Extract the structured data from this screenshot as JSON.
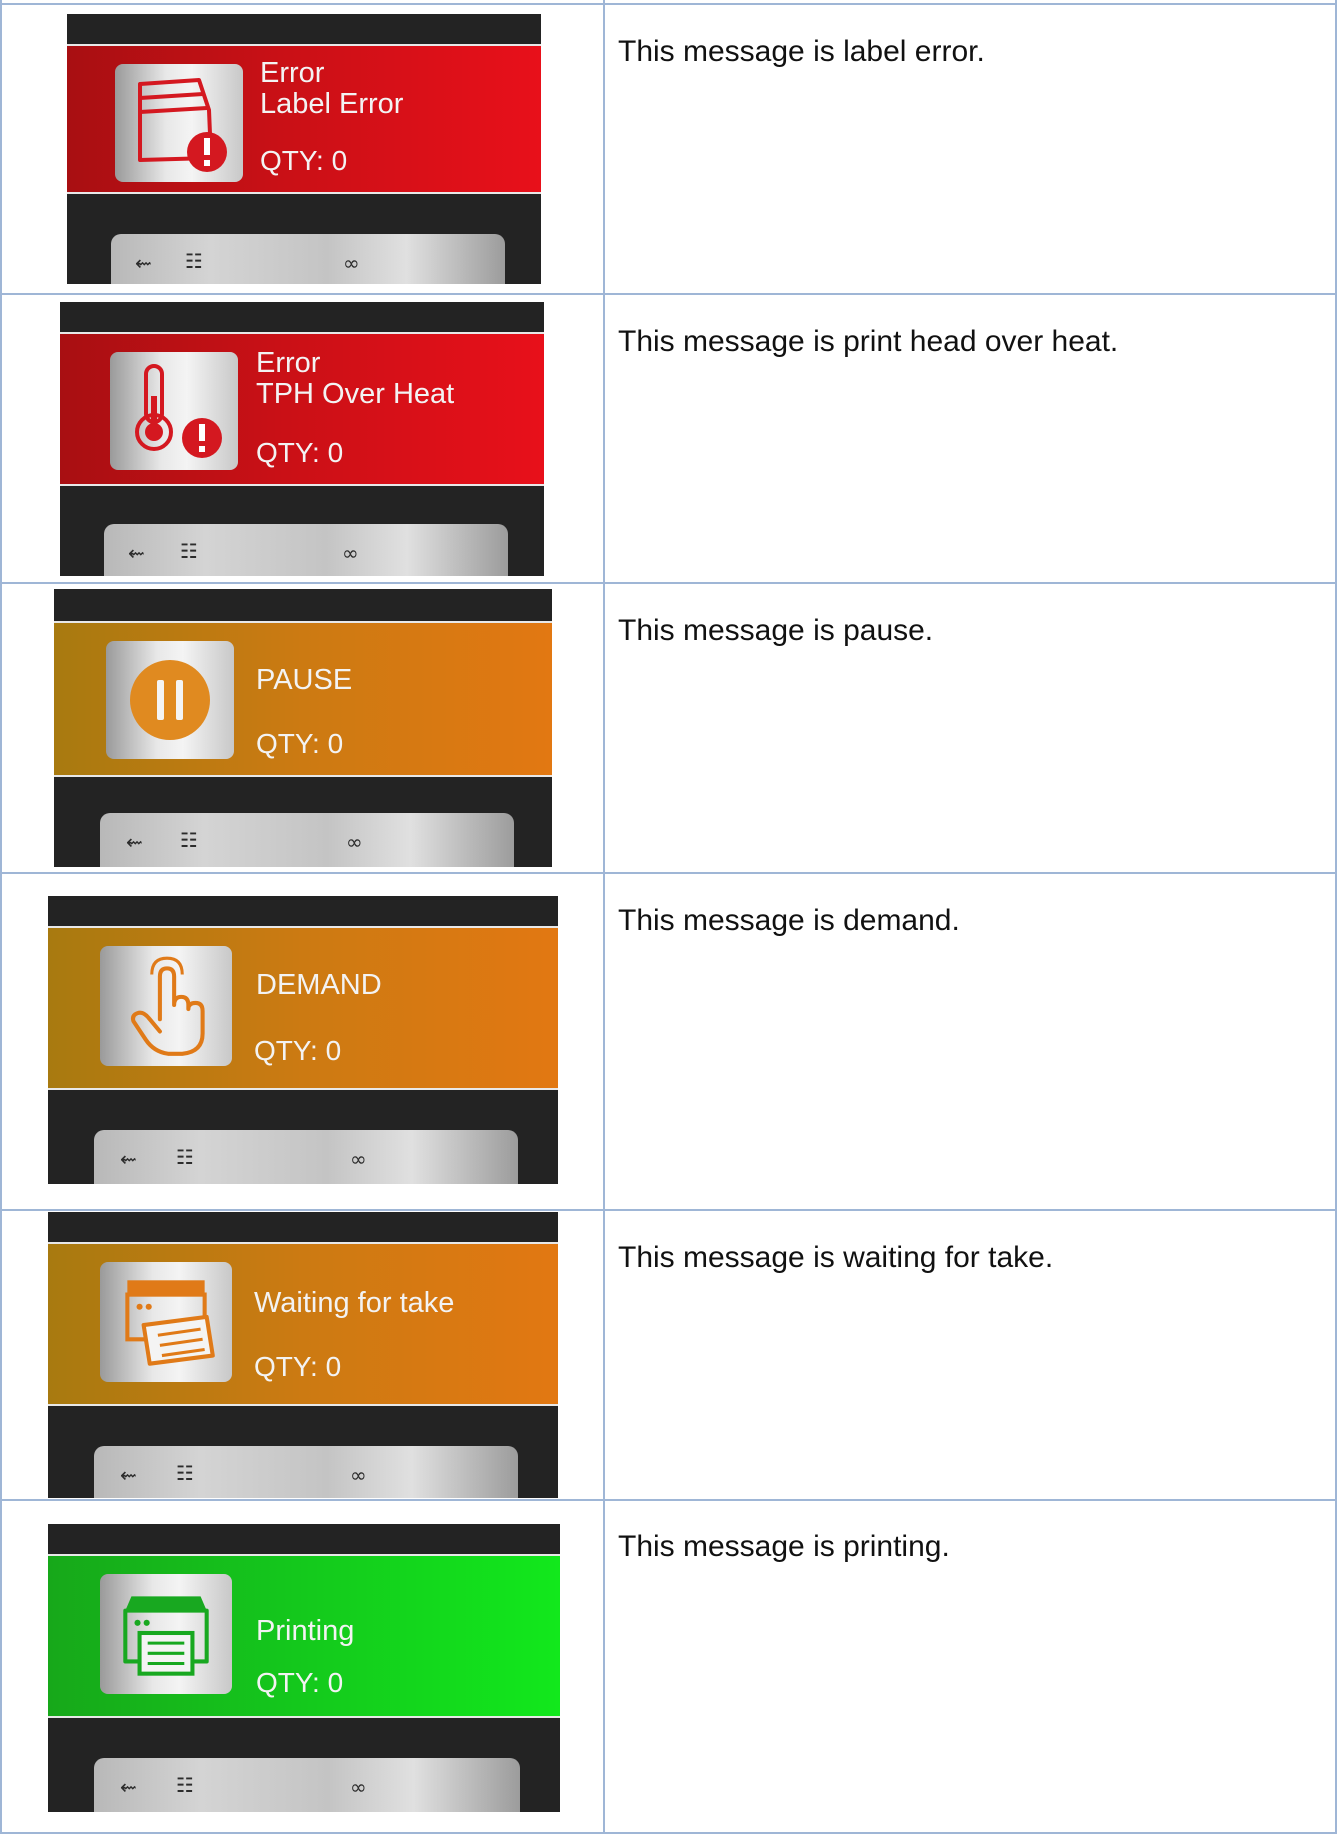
{
  "tray_icons": {
    "usb": "usb-icon",
    "network": "network-icon",
    "ribbon": "ribbon-icon"
  },
  "colors": {
    "error": "#d0101a",
    "warning": "#d07a12",
    "ok": "#14c91c"
  },
  "rows": [
    {
      "title": "Error\nLabel Error",
      "qty": "QTY: 0",
      "icon": "label-error-icon",
      "description": "This message is label error."
    },
    {
      "title": "Error\nTPH Over Heat",
      "qty": "QTY: 0",
      "icon": "thermometer-warning-icon",
      "description": "This message is print head over heat."
    },
    {
      "title": "PAUSE",
      "qty": "QTY: 0",
      "icon": "pause-icon",
      "description": "This message is pause."
    },
    {
      "title": "DEMAND",
      "qty": "QTY: 0",
      "icon": "hand-pointer-icon",
      "description": "This message is demand."
    },
    {
      "title": "Waiting for take",
      "qty": "QTY: 0",
      "icon": "printer-label-icon",
      "description": "This message is waiting for take."
    },
    {
      "title": "Printing",
      "qty": "QTY: 0",
      "icon": "printer-icon",
      "description": "This message is printing."
    }
  ]
}
